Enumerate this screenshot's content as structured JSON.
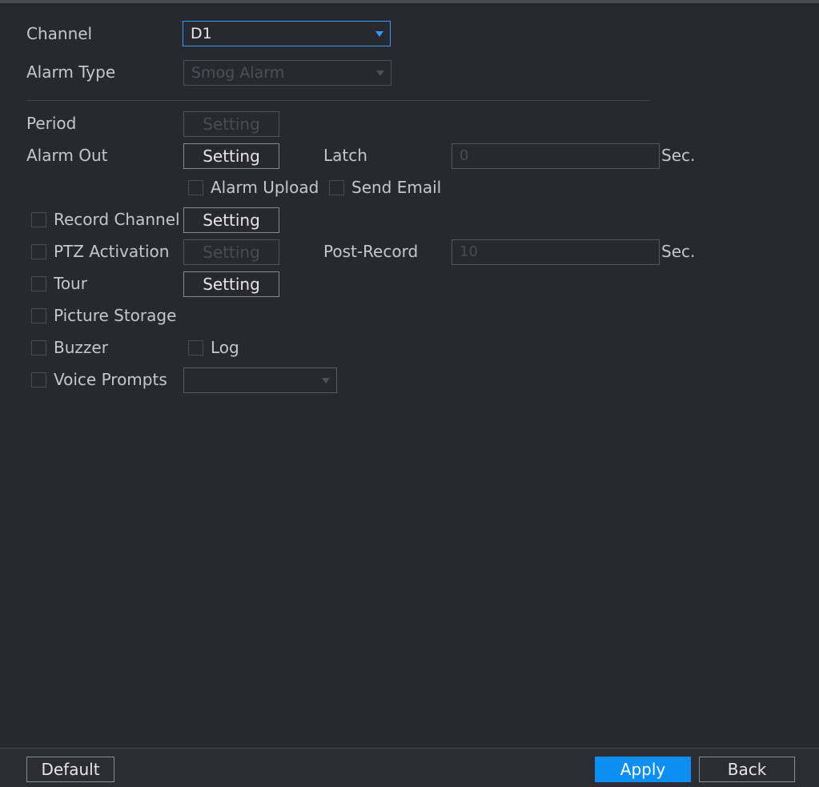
{
  "form": {
    "channel": {
      "label": "Channel",
      "value": "D1"
    },
    "alarm_type": {
      "label": "Alarm Type",
      "value": "Smog Alarm"
    },
    "period": {
      "label": "Period",
      "button": "Setting"
    },
    "alarm_out": {
      "label": "Alarm Out",
      "button": "Setting"
    },
    "latch": {
      "label": "Latch",
      "value": "0",
      "unit": "Sec."
    },
    "alarm_upload": {
      "label": "Alarm Upload"
    },
    "send_email": {
      "label": "Send Email"
    },
    "record_channel": {
      "label": "Record Channel",
      "button": "Setting"
    },
    "ptz_activation": {
      "label": "PTZ Activation",
      "button": "Setting"
    },
    "post_record": {
      "label": "Post-Record",
      "value": "10",
      "unit": "Sec."
    },
    "tour": {
      "label": "Tour",
      "button": "Setting"
    },
    "picture_storage": {
      "label": "Picture Storage"
    },
    "buzzer": {
      "label": "Buzzer"
    },
    "log": {
      "label": "Log"
    },
    "voice_prompts": {
      "label": "Voice Prompts",
      "value": ""
    }
  },
  "footer": {
    "default_label": "Default",
    "apply_label": "Apply",
    "back_label": "Back"
  },
  "colors": {
    "background": "#272830",
    "accent": "#0d8ff2",
    "active_border": "#2e9bff"
  }
}
